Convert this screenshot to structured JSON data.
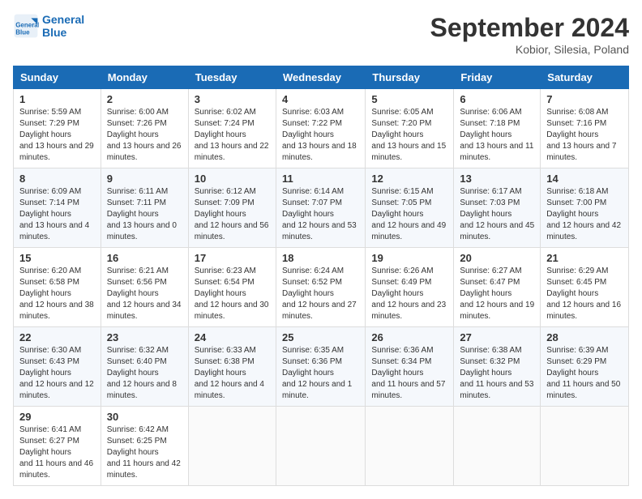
{
  "header": {
    "logo_line1": "General",
    "logo_line2": "Blue",
    "month": "September 2024",
    "location": "Kobior, Silesia, Poland"
  },
  "weekdays": [
    "Sunday",
    "Monday",
    "Tuesday",
    "Wednesday",
    "Thursday",
    "Friday",
    "Saturday"
  ],
  "weeks": [
    [
      {
        "day": "1",
        "sunrise": "5:59 AM",
        "sunset": "7:29 PM",
        "daylight": "13 hours and 29 minutes."
      },
      {
        "day": "2",
        "sunrise": "6:00 AM",
        "sunset": "7:26 PM",
        "daylight": "13 hours and 26 minutes."
      },
      {
        "day": "3",
        "sunrise": "6:02 AM",
        "sunset": "7:24 PM",
        "daylight": "13 hours and 22 minutes."
      },
      {
        "day": "4",
        "sunrise": "6:03 AM",
        "sunset": "7:22 PM",
        "daylight": "13 hours and 18 minutes."
      },
      {
        "day": "5",
        "sunrise": "6:05 AM",
        "sunset": "7:20 PM",
        "daylight": "13 hours and 15 minutes."
      },
      {
        "day": "6",
        "sunrise": "6:06 AM",
        "sunset": "7:18 PM",
        "daylight": "13 hours and 11 minutes."
      },
      {
        "day": "7",
        "sunrise": "6:08 AM",
        "sunset": "7:16 PM",
        "daylight": "13 hours and 7 minutes."
      }
    ],
    [
      {
        "day": "8",
        "sunrise": "6:09 AM",
        "sunset": "7:14 PM",
        "daylight": "13 hours and 4 minutes."
      },
      {
        "day": "9",
        "sunrise": "6:11 AM",
        "sunset": "7:11 PM",
        "daylight": "13 hours and 0 minutes."
      },
      {
        "day": "10",
        "sunrise": "6:12 AM",
        "sunset": "7:09 PM",
        "daylight": "12 hours and 56 minutes."
      },
      {
        "day": "11",
        "sunrise": "6:14 AM",
        "sunset": "7:07 PM",
        "daylight": "12 hours and 53 minutes."
      },
      {
        "day": "12",
        "sunrise": "6:15 AM",
        "sunset": "7:05 PM",
        "daylight": "12 hours and 49 minutes."
      },
      {
        "day": "13",
        "sunrise": "6:17 AM",
        "sunset": "7:03 PM",
        "daylight": "12 hours and 45 minutes."
      },
      {
        "day": "14",
        "sunrise": "6:18 AM",
        "sunset": "7:00 PM",
        "daylight": "12 hours and 42 minutes."
      }
    ],
    [
      {
        "day": "15",
        "sunrise": "6:20 AM",
        "sunset": "6:58 PM",
        "daylight": "12 hours and 38 minutes."
      },
      {
        "day": "16",
        "sunrise": "6:21 AM",
        "sunset": "6:56 PM",
        "daylight": "12 hours and 34 minutes."
      },
      {
        "day": "17",
        "sunrise": "6:23 AM",
        "sunset": "6:54 PM",
        "daylight": "12 hours and 30 minutes."
      },
      {
        "day": "18",
        "sunrise": "6:24 AM",
        "sunset": "6:52 PM",
        "daylight": "12 hours and 27 minutes."
      },
      {
        "day": "19",
        "sunrise": "6:26 AM",
        "sunset": "6:49 PM",
        "daylight": "12 hours and 23 minutes."
      },
      {
        "day": "20",
        "sunrise": "6:27 AM",
        "sunset": "6:47 PM",
        "daylight": "12 hours and 19 minutes."
      },
      {
        "day": "21",
        "sunrise": "6:29 AM",
        "sunset": "6:45 PM",
        "daylight": "12 hours and 16 minutes."
      }
    ],
    [
      {
        "day": "22",
        "sunrise": "6:30 AM",
        "sunset": "6:43 PM",
        "daylight": "12 hours and 12 minutes."
      },
      {
        "day": "23",
        "sunrise": "6:32 AM",
        "sunset": "6:40 PM",
        "daylight": "12 hours and 8 minutes."
      },
      {
        "day": "24",
        "sunrise": "6:33 AM",
        "sunset": "6:38 PM",
        "daylight": "12 hours and 4 minutes."
      },
      {
        "day": "25",
        "sunrise": "6:35 AM",
        "sunset": "6:36 PM",
        "daylight": "12 hours and 1 minute."
      },
      {
        "day": "26",
        "sunrise": "6:36 AM",
        "sunset": "6:34 PM",
        "daylight": "11 hours and 57 minutes."
      },
      {
        "day": "27",
        "sunrise": "6:38 AM",
        "sunset": "6:32 PM",
        "daylight": "11 hours and 53 minutes."
      },
      {
        "day": "28",
        "sunrise": "6:39 AM",
        "sunset": "6:29 PM",
        "daylight": "11 hours and 50 minutes."
      }
    ],
    [
      {
        "day": "29",
        "sunrise": "6:41 AM",
        "sunset": "6:27 PM",
        "daylight": "11 hours and 46 minutes."
      },
      {
        "day": "30",
        "sunrise": "6:42 AM",
        "sunset": "6:25 PM",
        "daylight": "11 hours and 42 minutes."
      },
      null,
      null,
      null,
      null,
      null
    ]
  ]
}
